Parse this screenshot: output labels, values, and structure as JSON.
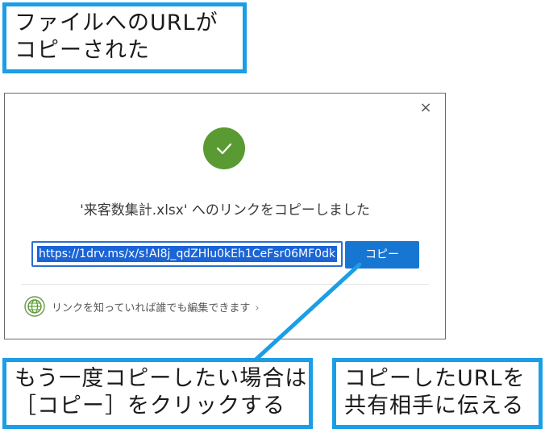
{
  "callouts": {
    "top": [
      "ファイルへのURLが",
      "コピーされた"
    ],
    "bottom_left": [
      "もう一度コピーしたい場合は",
      "［コピー］をクリックする"
    ],
    "bottom_right": [
      "コピーしたURLを",
      "共有相手に伝える"
    ]
  },
  "dialog": {
    "close_glyph": "×",
    "message": "'来客数集計.xlsx' へのリンクをコピーしました",
    "url_value": "https://1drv.ms/x/s!AI8j_qdZHlu0kEh1CeFsr06MF0dk",
    "copy_label": "コピー",
    "share_text": "リンクを知っていれば誰でも編集できます",
    "share_chevron": "›"
  },
  "colors": {
    "callout_border": "#1a9ee6",
    "success_green": "#5a9a32",
    "copy_button": "#1776d2",
    "selection": "#1a64d6"
  }
}
